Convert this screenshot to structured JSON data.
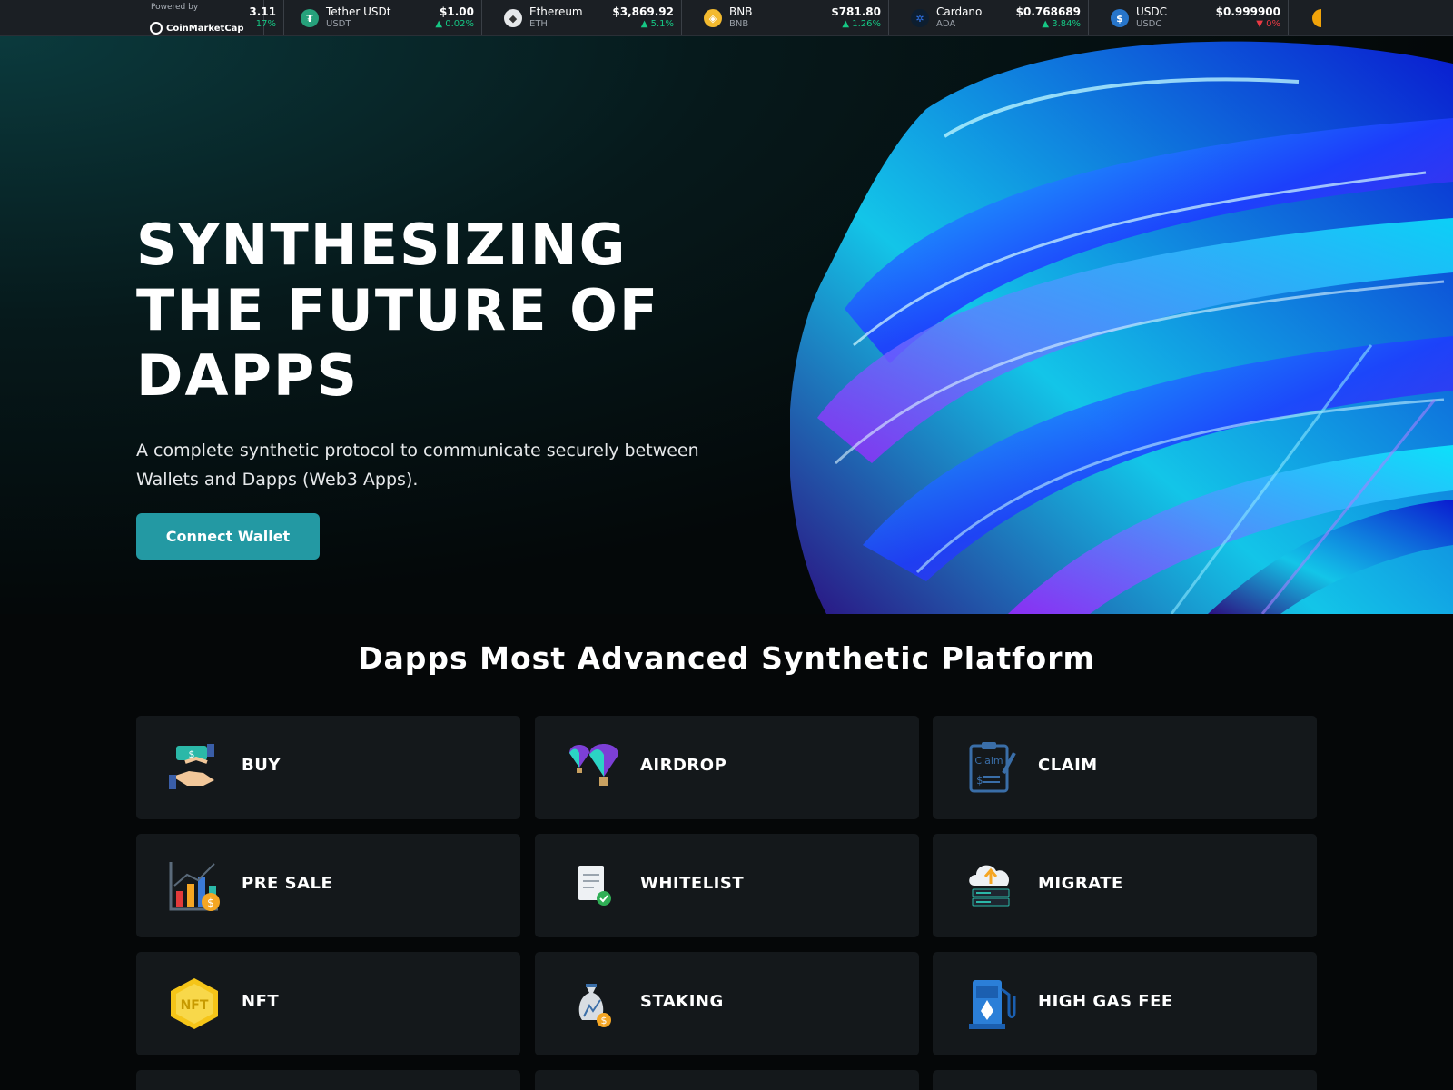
{
  "ticker": {
    "powered_by": "Powered by",
    "brand": "CoinMarketCap",
    "partial_price": "3.11",
    "partial_change": "17%",
    "items": [
      {
        "name": "Tether USDt",
        "symbol": "USDT",
        "price": "$1.00",
        "change": "▲ 0.02%",
        "direction": "up",
        "color": "#26a17b",
        "glyph": "₮"
      },
      {
        "name": "Ethereum",
        "symbol": "ETH",
        "price": "$3,869.92",
        "change": "▲ 5.1%",
        "direction": "up",
        "color": "#e6e8ea",
        "glyph": "◆"
      },
      {
        "name": "BNB",
        "symbol": "BNB",
        "price": "$781.80",
        "change": "▲ 1.26%",
        "direction": "up",
        "color": "#f3ba2f",
        "glyph": "◈"
      },
      {
        "name": "Cardano",
        "symbol": "ADA",
        "price": "$0.768689",
        "change": "▲ 3.84%",
        "direction": "up",
        "color": "#0d1e30",
        "glyph": "✲"
      },
      {
        "name": "USDC",
        "symbol": "USDC",
        "price": "$0.999900",
        "change": "▼ 0%",
        "direction": "down",
        "color": "#2775ca",
        "glyph": "$"
      }
    ]
  },
  "hero": {
    "title_line1": "SYNTHESIZING",
    "title_line2": "THE FUTURE OF",
    "title_line3": "DAPPS",
    "subtitle": "A complete synthetic protocol to communicate securely between Wallets and Dapps (Web3 Apps).",
    "cta": "Connect Wallet"
  },
  "features": {
    "title": "Dapps Most Advanced Synthetic Platform",
    "cards": [
      {
        "label": "BUY",
        "icon": "handshake-coin-icon"
      },
      {
        "label": "AIRDROP",
        "icon": "parachute-balloon-icon"
      },
      {
        "label": "CLAIM",
        "icon": "claim-clipboard-icon"
      },
      {
        "label": "PRE SALE",
        "icon": "bar-chart-coin-icon"
      },
      {
        "label": "WHITELIST",
        "icon": "document-check-icon"
      },
      {
        "label": "MIGRATE",
        "icon": "cloud-server-upload-icon"
      },
      {
        "label": "NFT",
        "icon": "nft-hexagon-icon"
      },
      {
        "label": "STAKING",
        "icon": "money-bag-stack-icon"
      },
      {
        "label": "HIGH GAS FEE",
        "icon": "gas-pump-icon"
      }
    ]
  }
}
